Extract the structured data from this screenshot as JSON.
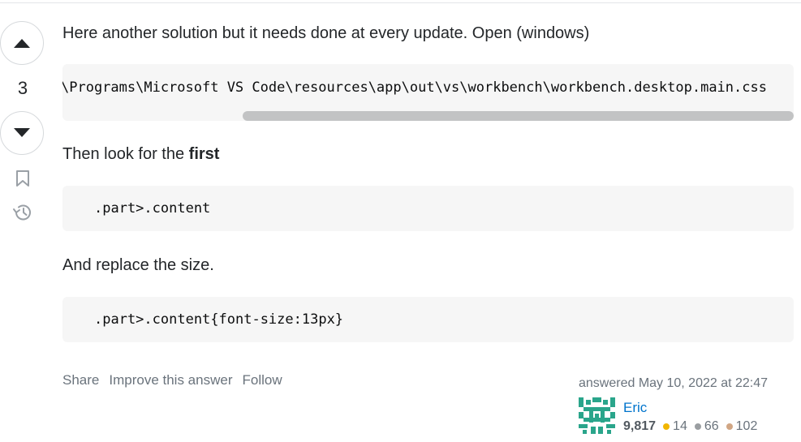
{
  "vote": {
    "count": "3"
  },
  "answer": {
    "paragraphs": [
      {
        "text": "Here another solution but it needs done at every update. Open (windows)"
      },
      {
        "prefix": "Then look for the ",
        "bold": "first"
      },
      {
        "text": "And replace the size."
      }
    ],
    "code_blocks": [
      "\\Programs\\Microsoft VS Code\\resources\\app\\out\\vs\\workbench\\workbench.desktop.main.css",
      ".part>.content",
      ".part>.content{font-size:13px}"
    ]
  },
  "menu": {
    "share": "Share",
    "improve": "Improve this answer",
    "follow": "Follow"
  },
  "user": {
    "answered_label": "answered May 10, 2022 at 22:47",
    "name": "Eric",
    "reputation": "9,817",
    "badges": {
      "gold": "14",
      "silver": "66",
      "bronze": "102"
    }
  },
  "colors": {
    "link": "#0074cc",
    "gold": "#f1b600",
    "silver": "#9a9ea1",
    "bronze": "#d1a684",
    "avatar": "#2aa58b"
  }
}
